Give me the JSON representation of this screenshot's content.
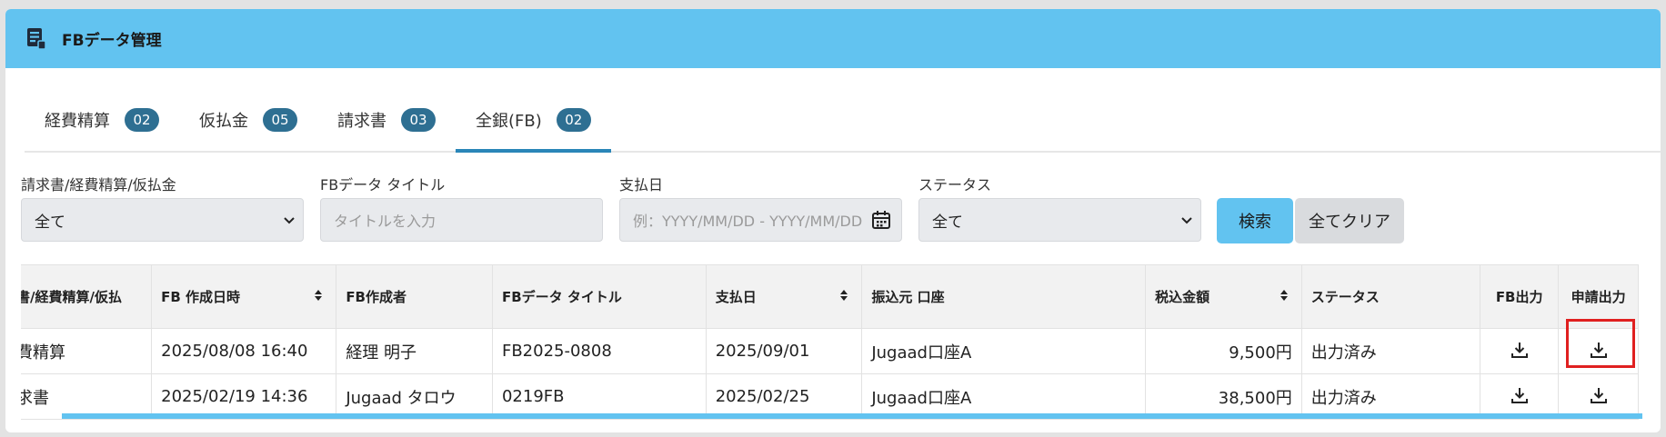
{
  "header": {
    "title": "FBデータ管理",
    "icon": "document-icon"
  },
  "tabs": [
    {
      "label": "経費精算",
      "count": "02"
    },
    {
      "label": "仮払金",
      "count": "05"
    },
    {
      "label": "請求書",
      "count": "03"
    },
    {
      "label": "全銀(FB)",
      "count": "02"
    }
  ],
  "active_tab": 3,
  "filters": {
    "type": {
      "label": "請求書/経費精算/仮払金",
      "value": "全て"
    },
    "title": {
      "label": "FBデータ タイトル",
      "placeholder": "タイトルを入力"
    },
    "paydate": {
      "label": "支払日",
      "placeholder": "例：YYYY/MM/DD - YYYY/MM/DD"
    },
    "status": {
      "label": "ステータス",
      "value": "全て"
    }
  },
  "buttons": {
    "search": "検索",
    "clear": "全てクリア"
  },
  "table": {
    "headers": [
      "書/経費精算/仮払",
      "FB 作成日時",
      "FB作成者",
      "FBデータ タイトル",
      "支払日",
      "振込元 口座",
      "税込金額",
      "ステータス",
      "FB出力",
      "申請出力"
    ],
    "rows": [
      [
        "費精算",
        "2025/08/08 16:40",
        "経理 明子",
        "FB2025-0808",
        "2025/09/01",
        "Jugaad口座A",
        "9,500円",
        "出力済み"
      ],
      [
        "求書",
        "2025/02/19 14:36",
        "Jugaad タロウ",
        "0219FB",
        "2025/02/25",
        "Jugaad口座A",
        "38,500円",
        "出力済み"
      ]
    ]
  },
  "colors": {
    "header_bg": "#62c3f0",
    "badge": "#2e6f92",
    "tab_active": "#2a86b8",
    "highlight": "#e02020"
  }
}
